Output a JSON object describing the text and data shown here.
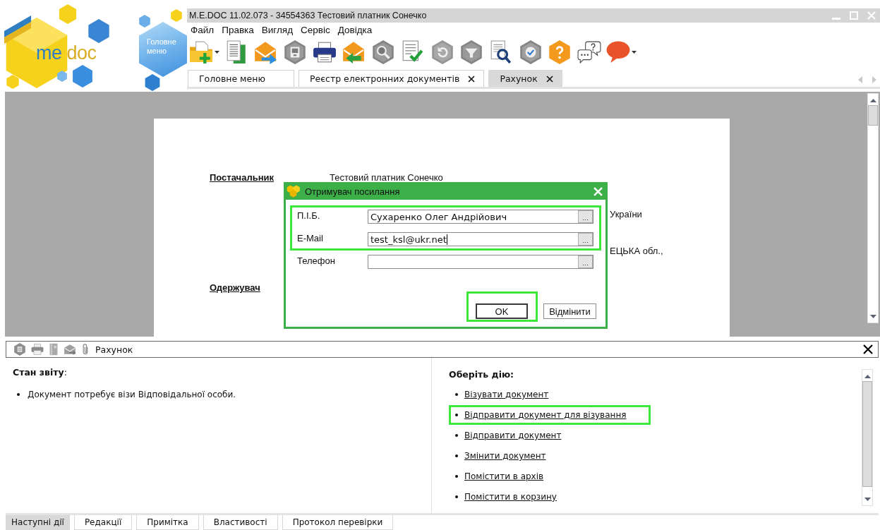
{
  "logo": {
    "words": [
      "me",
      "doc"
    ]
  },
  "home_button": {
    "label": "Головне меню"
  },
  "window": {
    "title": "M.E.DOC 11.02.073 - 34554363 Тестовий платник Сонечко"
  },
  "menu": [
    "Файл",
    "Правка",
    "Вигляд",
    "Сервіс",
    "Довідка"
  ],
  "tabs": [
    {
      "label": "Головне меню",
      "selected": false,
      "closable": false
    },
    {
      "label": "Реєстр електронних документів",
      "selected": false,
      "closable": true
    },
    {
      "label": "Рахунок",
      "selected": true,
      "closable": true
    }
  ],
  "document": {
    "rows": [
      {
        "column_1": "Постачальник",
        "column_2": "Тестовий платник Сонечко"
      },
      {
        "column_3": "України"
      },
      {
        "column_3": "ЕЦЬКА обл.,"
      },
      {
        "column_1": "Одержувач"
      }
    ]
  },
  "dialog": {
    "title": "Отримувач посилання",
    "fields": [
      {
        "label": "П.І.Б.",
        "value": "Сухаренко Олег Андрійович",
        "button": "...",
        "highlighted": true,
        "focused": false
      },
      {
        "label": "E-Mail",
        "value": "test_ksl@ukr.net",
        "button": "...",
        "highlighted": true,
        "focused": true
      },
      {
        "label": "Телефон",
        "button": "...",
        "highlighted": false,
        "focused": false
      }
    ],
    "buttons": [
      {
        "label": "OK",
        "default": true,
        "highlighted": true
      },
      {
        "label": "Відмінити",
        "default": false,
        "highlighted": false
      }
    ]
  },
  "panel": {
    "title": "Рахунок",
    "status": {
      "heading": "**Стан звіту**:",
      "items": [
        "Документ потребує візи Відповідальної особи."
      ]
    },
    "actions": {
      "heading": "Оберіть дію:",
      "items": [
        {
          "label": "Візувати документ",
          "highlighted": false
        },
        {
          "label": "Відправити документ для візування",
          "highlighted": true
        },
        {
          "label": "Відправити документ",
          "highlighted": false
        },
        {
          "label": "Змінити документ",
          "highlighted": false
        },
        {
          "label": "Помістити в архів",
          "highlighted": false
        },
        {
          "label": "Помістити в корзину",
          "highlighted": false
        }
      ]
    }
  },
  "bottom_tabs": [
    {
      "label": "Наступні дії",
      "selected": true
    },
    {
      "label": "Редакції",
      "selected": false
    },
    {
      "label": "Примітка",
      "selected": false
    },
    {
      "label": "Властивості",
      "selected": false
    },
    {
      "label": "Протокол перевірки",
      "selected": false
    }
  ]
}
